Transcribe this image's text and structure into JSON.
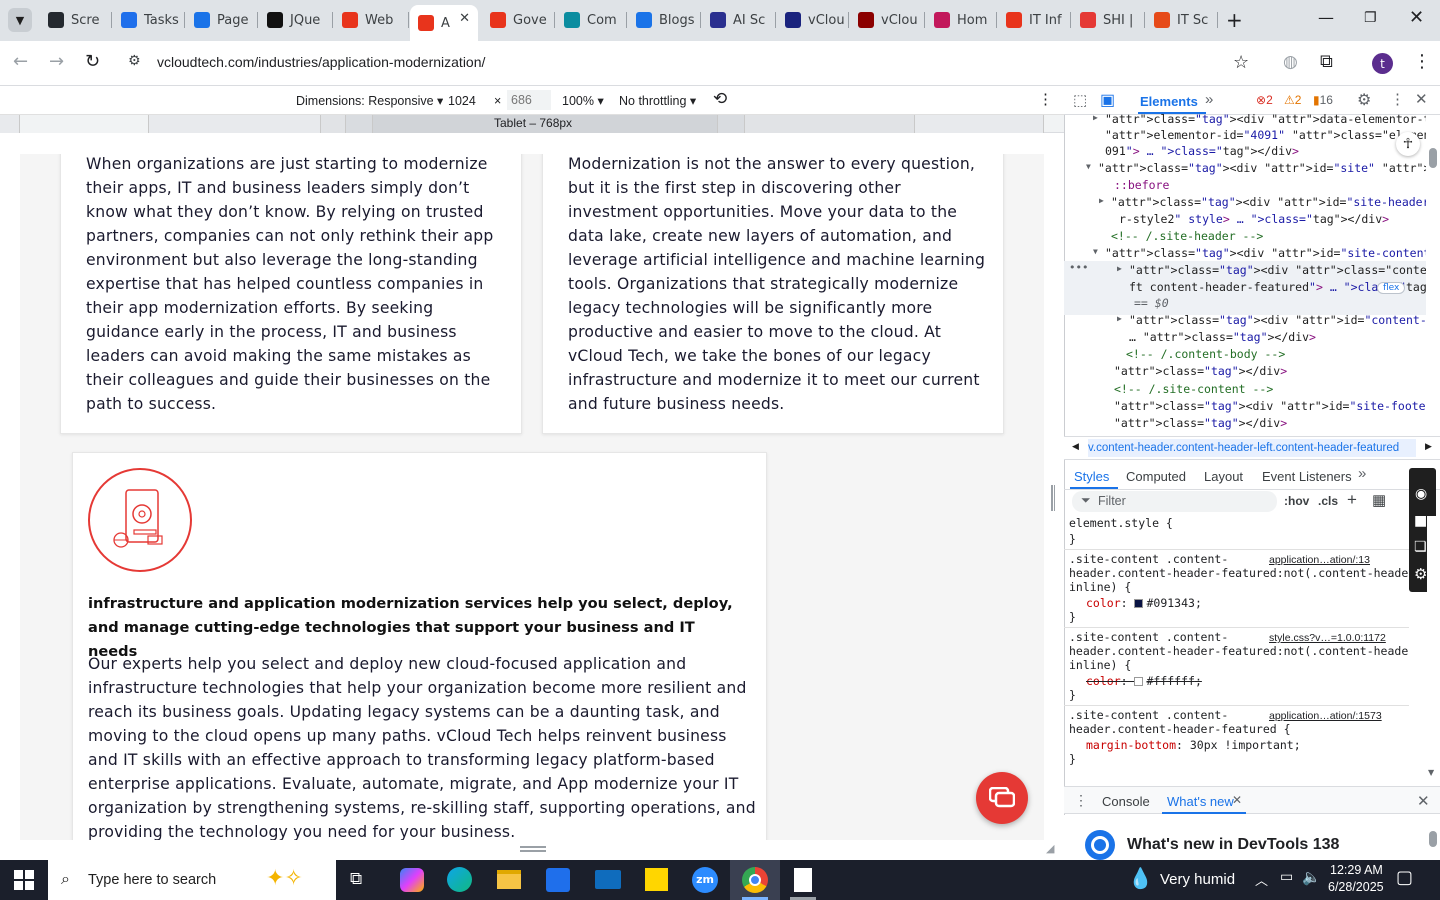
{
  "browser": {
    "tabs": [
      {
        "label": "Scre",
        "icon": "github-icon",
        "color": "#24292f"
      },
      {
        "label": "Tasks",
        "icon": "tasks-icon",
        "color": "#1f6feb"
      },
      {
        "label": "Page",
        "icon": "speedometer-icon",
        "color": "#1a73e8"
      },
      {
        "label": "JQue",
        "icon": "openai-icon",
        "color": "#111111"
      },
      {
        "label": "Web",
        "icon": "vcloud-icon",
        "color": "#e8341c"
      },
      {
        "label": "A",
        "icon": "vcloud-icon",
        "color": "#e8341c",
        "active": true
      },
      {
        "label": "Gove",
        "icon": "vcloud-icon",
        "color": "#e8341c"
      },
      {
        "label": "Com",
        "icon": "cloud-icon",
        "color": "#0b8da0"
      },
      {
        "label": "Blogs",
        "icon": "blog-icon",
        "color": "#1a73e8"
      },
      {
        "label": "AI Sc",
        "icon": "x-logo-icon",
        "color": "#2a2f8f"
      },
      {
        "label": "vClou",
        "icon": "check-icon",
        "color": "#1a237e"
      },
      {
        "label": "vClou",
        "icon": "v-logo-icon",
        "color": "#8b0000"
      },
      {
        "label": "Hom",
        "icon": "ai-icon",
        "color": "#c2185b"
      },
      {
        "label": "IT Inf",
        "icon": "vcloud-icon",
        "color": "#e8341c"
      },
      {
        "label": "SHI |",
        "icon": "circle-icon",
        "color": "#e53935"
      },
      {
        "label": "IT Sc",
        "icon": "bolt-icon",
        "color": "#e64a19"
      }
    ],
    "url": "vcloudtech.com/industries/application-modernization/",
    "profile_initial": "t"
  },
  "device_toolbar": {
    "dimensions_label": "Dimensions: Responsive",
    "width": "1024",
    "times": "×",
    "height": "686",
    "zoom": "100%",
    "throttling": "No throttling",
    "media_query_label": "Tablet – 768px"
  },
  "page": {
    "card1_text": "When organizations are just starting to modernize their apps, IT and business leaders simply don’t know what they don’t know. By relying on trusted partners, companies can not only rethink their app environment but also leverage the long-standing expertise that has helped countless companies in their app modernization efforts. By seeking guidance early in the process, IT and business leaders can avoid making the same mistakes as their colleagues and guide their businesses on the path to success.",
    "card2_text": "Modernization is not the answer to every question, but it is the first step in discovering other investment opportunities. Move your data to the data lake, create new layers of automation, and leverage artificial intelligence and machine learning tools. Organizations that strategically modernize legacy technologies will be significantly more productive and easier to move to the cloud. At vCloud Tech, we take the bones of our legacy infrastructure and modernize it to meet our current and future business needs.",
    "card3_heading": "infrastructure and application modernization services help you select, deploy, and manage cutting-edge technologies that support your business and IT needs",
    "card3_text": "Our experts help you select and deploy new cloud-focused application and infrastructure technologies that help your organization become more resilient and reach its business goals. Updating legacy systems can be a daunting task, and moving to the cloud opens up many paths. vCloud Tech helps reinvent business and IT skills with an effective approach to transforming legacy platform-based enterprise applications. Evaluate, automate, migrate, and App modernize your IT organization by strengthening systems, re-skilling staff, supporting operations, and providing the technology you need for your business.",
    "accent_color": "#e53935"
  },
  "devtools": {
    "tabs": [
      "Elements"
    ],
    "errors": "2",
    "warnings": "2",
    "issues": "16",
    "dom_lines": [
      "<div data-elementor-type=\"wp-post\" data-",
      "elementor-id=\"4091\" class=\"elementor element-4",
      "091\"> … </div>",
      "<div id=\"site\" class=\"site wrap scrolling_up\">",
      "::before",
      "<div id=\"site-header\" class=\"site-header heade",
      "r-style2\" style> … </div>",
      "<!-- /.site-header -->",
      "<div id=\"site-content\" class=\"site-content\">",
      "<div class=\"content-header content-header-le",
      "ft content-header-featured\"> … </div>",
      "== $0",
      "<div id=\"content-body\" class=\"content-body\">",
      " … </div>",
      "<!-- /.content-body -->",
      "</div>",
      "<!-- /.site-content -->",
      "<div id=\"site-footer\" class=\"site-footer\">",
      "</div>"
    ],
    "flex_badge": "flex",
    "breadcrumb": "v.content-header.content-header-left.content-header-featured",
    "styles_tabs": [
      "Styles",
      "Computed",
      "Layout",
      "Event Listeners"
    ],
    "filter_placeholder": "Filter",
    "hov": ":hov",
    "cls": ".cls",
    "rules": [
      {
        "selector": "element.style {",
        "source": "",
        "decls": [],
        "close": "}"
      },
      {
        "selector": ".site-content .content-",
        "selector2": "header.content-header-featured:not(.content-header-",
        "selector3": "inline) {",
        "source": "application…ation/:13",
        "decls": [
          {
            "prop": "color",
            "value": "#091343",
            "swatch": "#091343"
          }
        ],
        "close": "}"
      },
      {
        "selector": ".site-content .content-",
        "selector2": "header.content-header-featured:not(.content-header-",
        "selector3": "inline) {",
        "source": "style.css?v…=1.0.0:1172",
        "decls": [
          {
            "prop": "color",
            "value": "#ffffff",
            "swatch": "#ffffff",
            "struck": true
          }
        ],
        "close": "}"
      },
      {
        "selector": ".site-content .content-",
        "selector2": "header.content-header-featured {",
        "selector3": "",
        "source": "application…ation/:1573",
        "decls": [
          {
            "prop": "margin-bottom",
            "value": "30px !important"
          }
        ],
        "close": "}"
      }
    ],
    "drawer_tabs": [
      "Console",
      "What's new"
    ],
    "whats_new_title": "What's new in DevTools 138"
  },
  "taskbar": {
    "search_placeholder": "Type here to search",
    "weather": "Very humid",
    "time": "12:29 AM",
    "date": "6/28/2025"
  }
}
